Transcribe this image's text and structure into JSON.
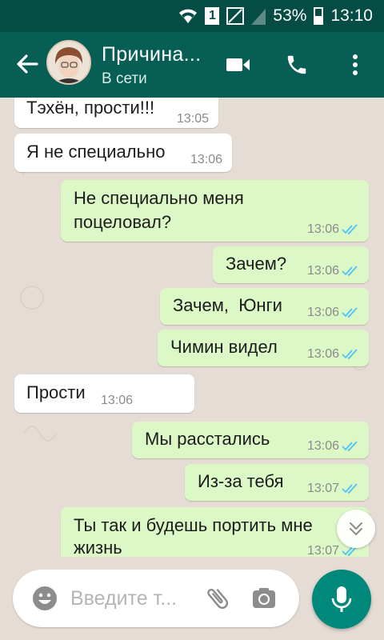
{
  "status_bar": {
    "sim_label": "1",
    "battery_percent": "53%",
    "time": "13:10"
  },
  "header": {
    "contact_name": "Причина...",
    "contact_status": "В сети"
  },
  "messages": [
    {
      "direction": "in",
      "text": "Тэхён, прости!!!",
      "time": "13:05"
    },
    {
      "direction": "in",
      "text": "Я не специально",
      "time": "13:06"
    },
    {
      "direction": "out",
      "text_lines": [
        "Не специально меня",
        "поцеловал?"
      ],
      "time": "13:06",
      "read": true
    },
    {
      "direction": "out",
      "text": "Зачем?",
      "time": "13:06",
      "read": true
    },
    {
      "direction": "out",
      "text": "Зачем,  Юнги",
      "time": "13:06",
      "read": true
    },
    {
      "direction": "out",
      "text": "Чимин видел",
      "time": "13:06",
      "read": true
    },
    {
      "direction": "in",
      "text": "Прости",
      "time": "13:06"
    },
    {
      "direction": "out",
      "text": "Мы расстались",
      "time": "13:06",
      "read": true
    },
    {
      "direction": "out",
      "text": "Из-за тебя",
      "time": "13:07",
      "read": true
    },
    {
      "direction": "out",
      "text_lines": [
        "Ты так и будешь портить мне",
        "жизнь"
      ],
      "time": "13:07",
      "read": true
    }
  ],
  "composer": {
    "placeholder": "Введите т..."
  },
  "colors": {
    "status_bar": "#054d44",
    "app_bar": "#075e54",
    "chat_background": "#e5ddd5",
    "incoming_bubble": "#ffffff",
    "outgoing_bubble": "#dcf8c6",
    "read_ticks": "#4fc3f7",
    "mic_button": "#00897b"
  },
  "icons": {
    "status": [
      "wifi-icon",
      "sim-icon",
      "no-signal-icon",
      "signal-icon",
      "battery-icon"
    ],
    "header": [
      "back-arrow-icon",
      "avatar",
      "video-call-icon",
      "phone-icon",
      "more-vert-icon"
    ],
    "composer": [
      "emoji-icon",
      "attach-icon",
      "camera-icon",
      "mic-icon",
      "scroll-down-icon"
    ]
  }
}
